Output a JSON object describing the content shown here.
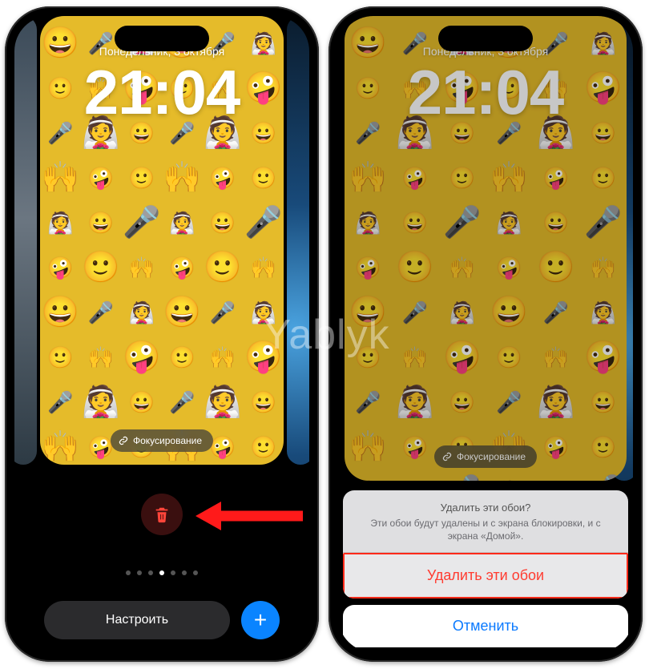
{
  "watermark": "Yablyk",
  "lockscreen": {
    "date": "Понедельник, 3 октября",
    "time": "21:04",
    "focus_label": "Фокусирование"
  },
  "editor": {
    "customize_label": "Настроить",
    "page_dots": {
      "count": 7,
      "active_index": 3
    }
  },
  "emoji_set": [
    "😀",
    "🙂",
    "🎤",
    "🙌",
    "👰",
    "🤪"
  ],
  "action_sheet": {
    "title": "Удалить эти обои?",
    "message": "Эти обои будут удалены и с экрана блокировки, и с экрана «Домой».",
    "destructive_label": "Удалить эти обои",
    "cancel_label": "Отменить"
  },
  "colors": {
    "accent_blue": "#0a84ff",
    "destructive_red": "#ff3b30",
    "wallpaper_bg": "#e5bb2a",
    "delete_circle_bg": "#3a0f0f"
  }
}
